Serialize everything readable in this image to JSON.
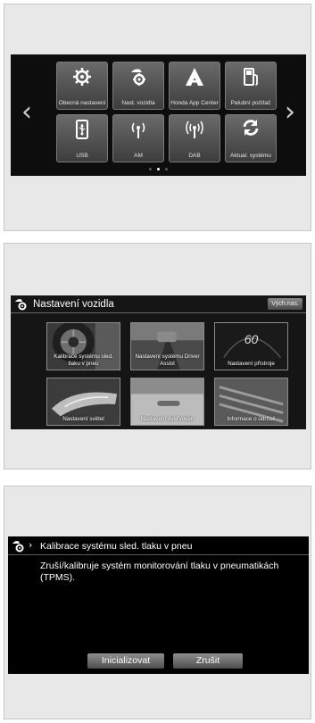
{
  "home_menu": {
    "tiles": [
      {
        "label": "Obecná nastavení",
        "icon": "gear-icon"
      },
      {
        "label": "Nast. vozidla",
        "icon": "vehicle-gear-icon"
      },
      {
        "label": "Honda App Center",
        "icon": "app-center-icon"
      },
      {
        "label": "Palubní počítač",
        "icon": "fuel-pump-icon"
      },
      {
        "label": "USB",
        "icon": "usb-icon"
      },
      {
        "label": "AM",
        "icon": "radio-antenna-icon"
      },
      {
        "label": "DAB",
        "icon": "radio-antenna-icon"
      },
      {
        "label": "Aktual. systému",
        "icon": "refresh-icon"
      }
    ],
    "page_count": 3,
    "active_page": 2
  },
  "vehicle_settings": {
    "title": "Nastavení vozidla",
    "defaults_button": "Vých.nas.",
    "cards": [
      {
        "label": "Kalibrace systému sled. tlaku v pneu"
      },
      {
        "label": "Nastavení systému Driver Assist"
      },
      {
        "label": "Nastavení přístroje",
        "value": "60"
      },
      {
        "label": "Nastavení světel"
      },
      {
        "label": "Nastavení dveří/oken"
      },
      {
        "label": "Informace o údržbě"
      }
    ]
  },
  "tpms_calibration": {
    "title": "Kalibrace systému sled. tlaku v pneu",
    "description": "Zruší/kalibruje systém monitorování tlaku v pneumatikách (TPMS).",
    "initialize_button": "Inicializovat",
    "cancel_button": "Zrušit"
  }
}
